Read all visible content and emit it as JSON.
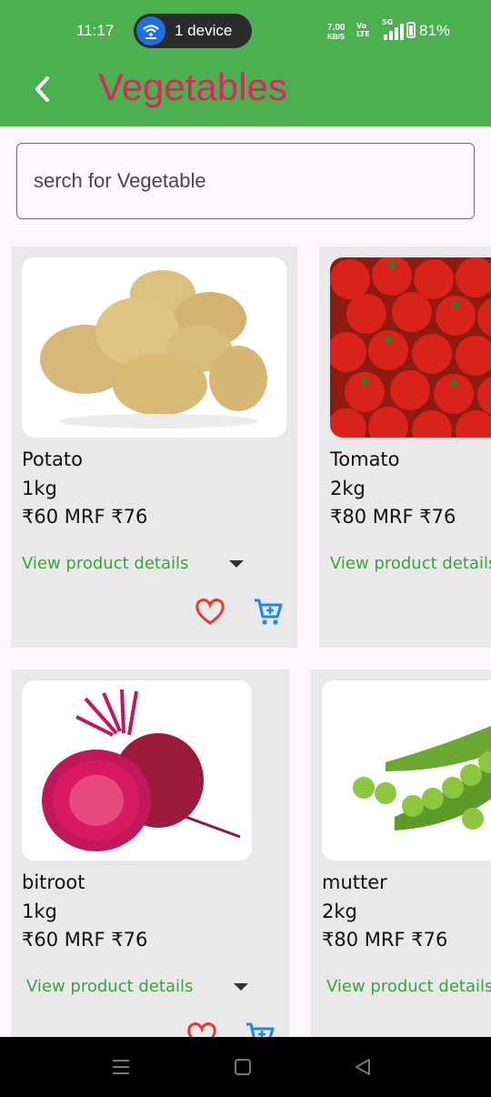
{
  "status_bar": {
    "time": "11:17",
    "pill_label": "1 device",
    "net_speed_top": "7.00",
    "net_speed_unit": "KB/S",
    "volte": "Vo LTE",
    "network": "5G",
    "battery": "81%"
  },
  "header": {
    "title": "Vegetables",
    "back_icon": "chevron-left-icon"
  },
  "search": {
    "placeholder": "serch for Vegetable"
  },
  "colors": {
    "appbar": "#4caf50",
    "title": "#e0245e",
    "accent_green": "#3aa23f",
    "heart": "#e53935",
    "cart": "#1e88e5",
    "card_bg": "#e9e9e9"
  },
  "products": [
    {
      "name": "Potato",
      "qty": "1kg",
      "price": "₹60 MRF ₹76",
      "details": "View product details",
      "favorite_icon": "heart-outline-icon",
      "cart_icon": "cart-add-icon"
    },
    {
      "name": "Tomato",
      "qty": "2kg",
      "price": "₹80 MRF ₹76",
      "details": "View product details"
    },
    {
      "name": "bitroot",
      "qty": "1kg",
      "price": "₹60 MRF ₹76",
      "details": "View product details",
      "favorite_icon": "heart-outline-icon",
      "cart_icon": "cart-add-icon"
    },
    {
      "name": "mutter",
      "qty": "2kg",
      "price": "₹80 MRF ₹76",
      "details": "View product details"
    }
  ],
  "nav_bar": {
    "icons": [
      "menu-icon",
      "home-square-icon",
      "back-triangle-icon"
    ]
  }
}
